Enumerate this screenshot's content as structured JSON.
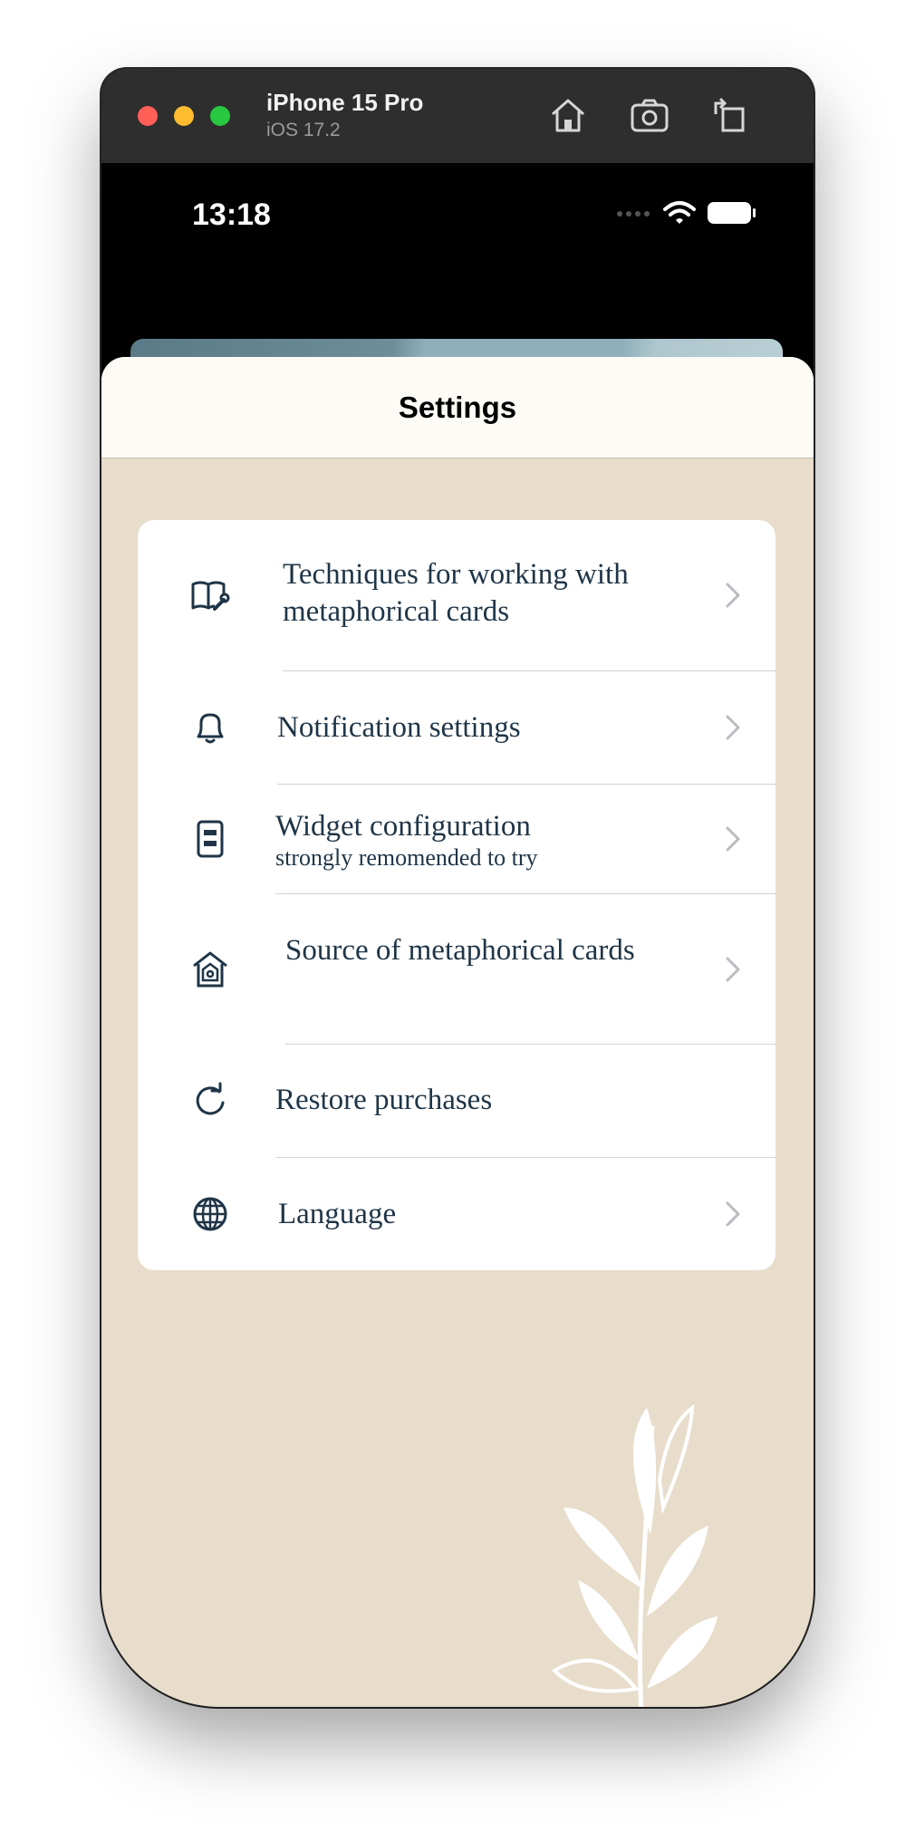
{
  "simulator": {
    "device_name": "iPhone 15 Pro",
    "os_version": "iOS 17.2",
    "toolbar_icons": [
      "home-icon",
      "screenshot-icon",
      "rotate-icon"
    ]
  },
  "status_bar": {
    "time": "13:18"
  },
  "sheet": {
    "title": "Settings"
  },
  "settings": {
    "items": [
      {
        "icon": "book-wrench-icon",
        "label": "Techniques for working with metaphorical cards",
        "has_chevron": true
      },
      {
        "icon": "bell-icon",
        "label": "Notification settings",
        "has_chevron": true
      },
      {
        "icon": "widget-icon",
        "label": "Widget configuration",
        "subtitle": "strongly remomended to try",
        "has_chevron": true
      },
      {
        "icon": "house-source-icon",
        "label": "Source of metaphorical cards",
        "has_chevron": true
      },
      {
        "icon": "restore-icon",
        "label": "Restore purchases",
        "has_chevron": false
      },
      {
        "icon": "globe-icon",
        "label": "Language",
        "has_chevron": true
      }
    ]
  },
  "colors": {
    "background": "#e8dccb",
    "card": "#ffffff",
    "text": "#1f3547",
    "header": "#fdfbf6"
  }
}
